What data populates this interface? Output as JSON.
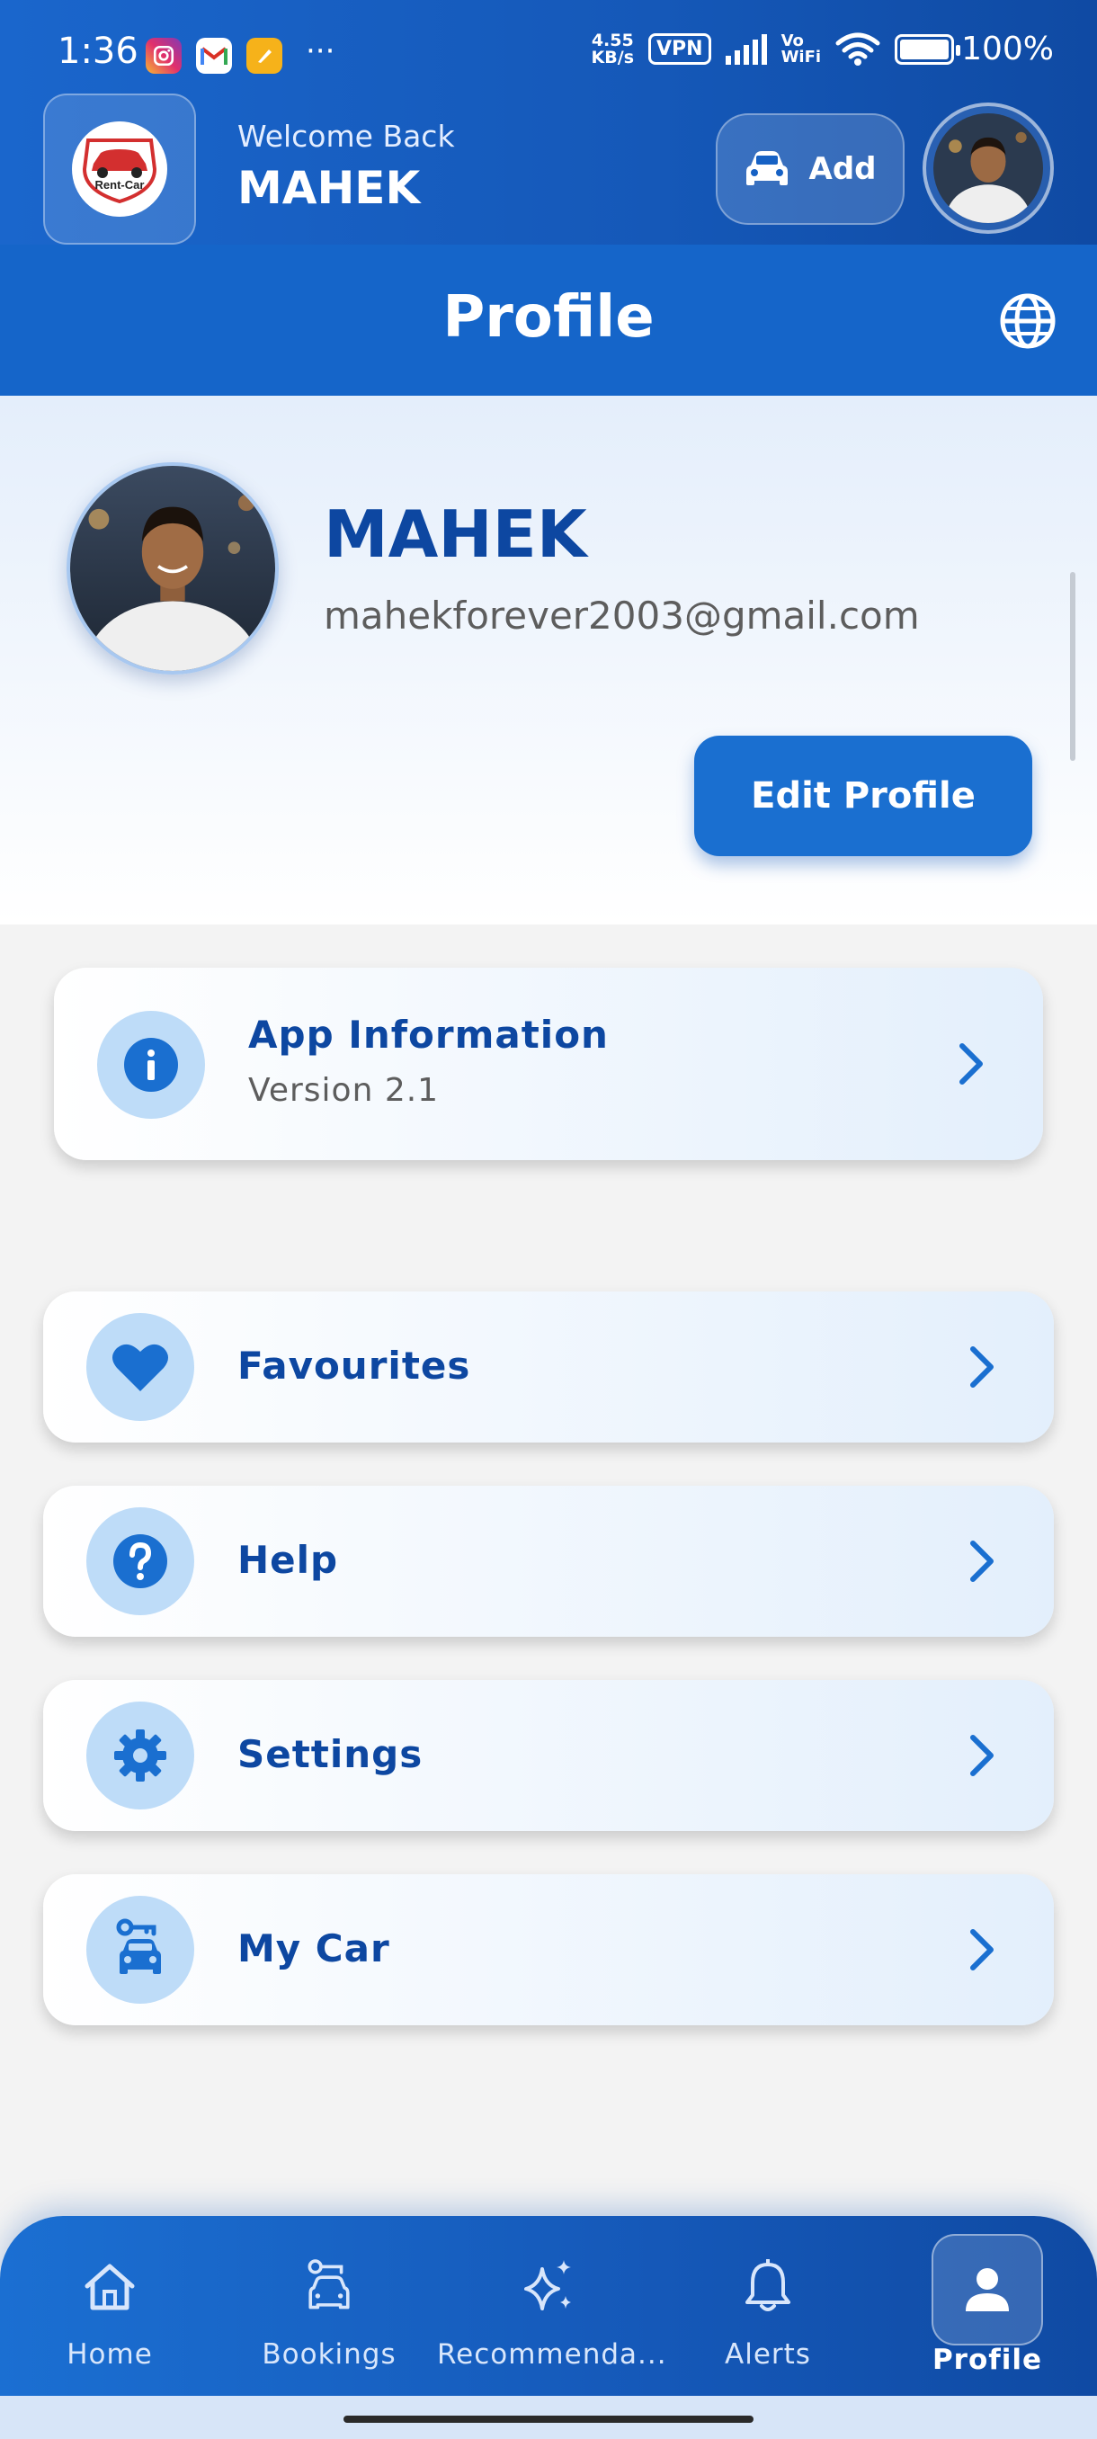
{
  "status_bar": {
    "time": "1:36",
    "more": "···",
    "net_speed_value": "4.55",
    "net_speed_unit": "KB/s",
    "vpn": "VPN",
    "vowifi_top": "Vo",
    "vowifi_bottom": "WiFi",
    "battery": "100%"
  },
  "header": {
    "logo_text": "Rent-Car",
    "welcome_text": "Welcome Back",
    "user_name": "MAHEK",
    "add_label": "Add"
  },
  "page": {
    "title": "Profile"
  },
  "profile": {
    "name": "MAHEK",
    "email": "mahekforever2003@gmail.com",
    "edit_label": "Edit Profile"
  },
  "info_card": {
    "title": "App Information",
    "subtitle": "Version 2.1",
    "icon": "info-icon"
  },
  "menu": {
    "items": [
      {
        "label": "Favourites",
        "icon": "heart-icon"
      },
      {
        "label": "Help",
        "icon": "help-icon"
      },
      {
        "label": "Settings",
        "icon": "gear-icon"
      },
      {
        "label": "My Car",
        "icon": "car-key-icon"
      }
    ]
  },
  "bottom_nav": {
    "items": [
      {
        "label": "Home",
        "icon": "home-icon"
      },
      {
        "label": "Bookings",
        "icon": "bookings-icon"
      },
      {
        "label": "Recommenda...",
        "icon": "sparkle-icon"
      },
      {
        "label": "Alerts",
        "icon": "bell-icon"
      },
      {
        "label": "Profile",
        "icon": "person-icon",
        "active": true
      }
    ]
  },
  "colors": {
    "primary": "#1565c9",
    "primary_dark": "#0d47a1",
    "icon_circle": "#bedcf8",
    "text_muted": "#5d5d5d"
  }
}
